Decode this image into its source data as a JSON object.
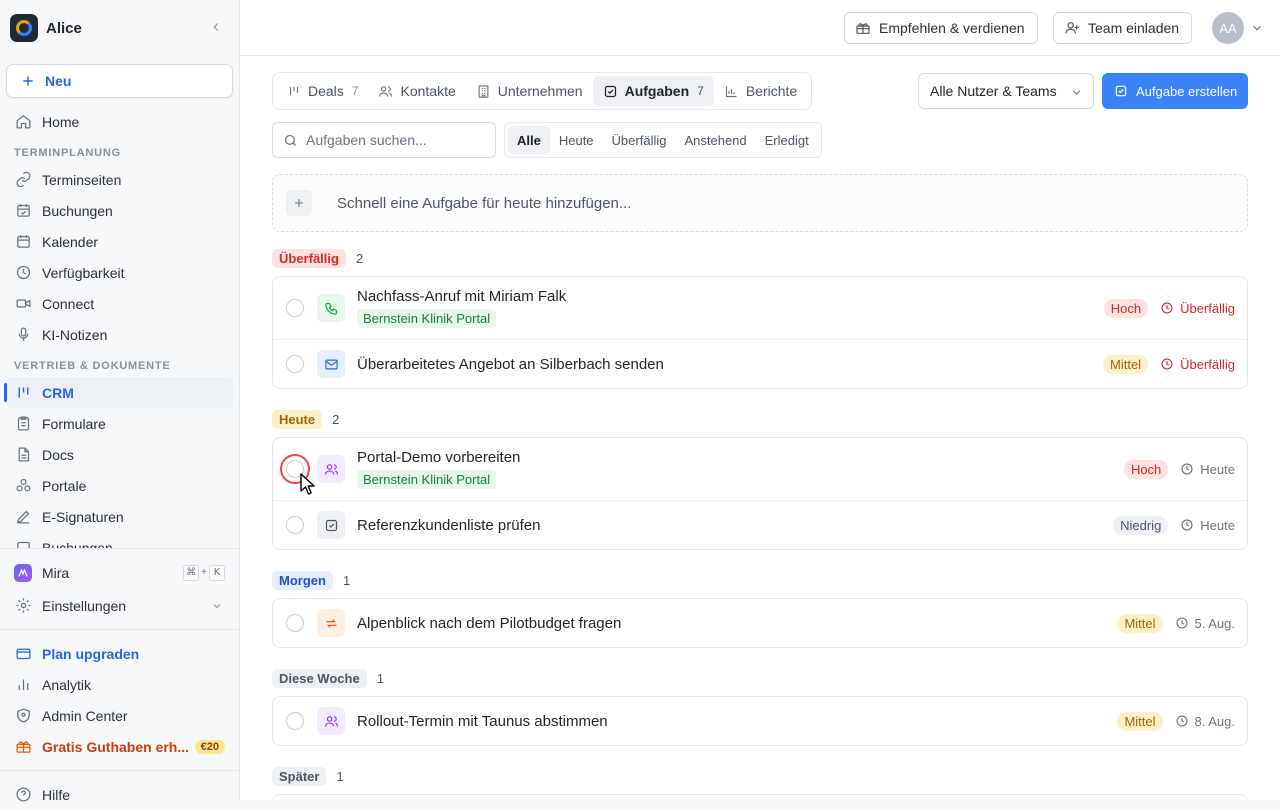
{
  "sidebar": {
    "workspace": "Alice",
    "new_label": "Neu",
    "items_top": [
      {
        "label": "Home",
        "icon": "home-icon"
      }
    ],
    "section1": "TERMINPLANUNG",
    "items_s1": [
      {
        "label": "Terminseiten",
        "icon": "link-icon"
      },
      {
        "label": "Buchungen",
        "icon": "calendar-check-icon"
      },
      {
        "label": "Kalender",
        "icon": "calendar-icon"
      },
      {
        "label": "Verfügbarkeit",
        "icon": "clock-icon"
      },
      {
        "label": "Connect",
        "icon": "video-icon"
      },
      {
        "label": "KI-Notizen",
        "icon": "mic-icon"
      }
    ],
    "section2": "VERTRIEB & DOKUMENTE",
    "items_s2": [
      {
        "label": "CRM",
        "icon": "crm-icon"
      },
      {
        "label": "Formulare",
        "icon": "clipboard-icon"
      },
      {
        "label": "Docs",
        "icon": "doc-icon"
      },
      {
        "label": "Portale",
        "icon": "portal-icon"
      },
      {
        "label": "E-Signaturen",
        "icon": "pen-icon"
      },
      {
        "label": "Buchungen",
        "icon": "calendar-icon"
      }
    ],
    "mira": "Mira",
    "mira_kbd": [
      "⌘",
      "+",
      "K"
    ],
    "settings": "Einstellungen",
    "upgrade": "Plan upgraden",
    "analytics": "Analytik",
    "admin": "Admin Center",
    "credit": "Gratis Guthaben erh...",
    "credit_badge": "€20",
    "help": "Hilfe"
  },
  "topbar": {
    "refer": "Empfehlen & verdienen",
    "invite": "Team einladen",
    "avatar": "AA"
  },
  "tabs": [
    {
      "label": "Deals",
      "count": "7",
      "icon": "pipeline-icon"
    },
    {
      "label": "Kontakte",
      "count": "",
      "icon": "contacts-icon"
    },
    {
      "label": "Unternehmen",
      "count": "",
      "icon": "building-icon"
    },
    {
      "label": "Aufgaben",
      "count": "7",
      "icon": "task-icon",
      "active": true
    },
    {
      "label": "Berichte",
      "count": "",
      "icon": "chart-icon"
    }
  ],
  "user_filter": "Alle Nutzer & Teams",
  "create_task": "Aufgabe erstellen",
  "search_placeholder": "Aufgaben suchen...",
  "filters": [
    "Alle",
    "Heute",
    "Überfällig",
    "Anstehend",
    "Erledigt"
  ],
  "quick_add": "Schnell eine Aufgabe für heute hinzufügen...",
  "groups": [
    {
      "label": "Überfällig",
      "count": "2",
      "style": "red",
      "tasks": [
        {
          "title": "Nachfass-Anruf mit Miriam Falk",
          "tag": "Bernstein Klinik Portal",
          "icon": "phone-icon",
          "icon_style": "green",
          "priority": "Hoch",
          "prio_style": "high",
          "due": "Überfällig",
          "overdue": true
        },
        {
          "title": "Überarbeitetes Angebot an Silberbach senden",
          "tag": "",
          "icon": "mail-icon",
          "icon_style": "blue",
          "priority": "Mittel",
          "prio_style": "mid",
          "due": "Überfällig",
          "overdue": true
        }
      ]
    },
    {
      "label": "Heute",
      "count": "2",
      "style": "yellow",
      "tasks": [
        {
          "title": "Portal-Demo vorbereiten",
          "tag": "Bernstein Klinik Portal",
          "icon": "meeting-icon",
          "icon_style": "purple",
          "priority": "Hoch",
          "prio_style": "high",
          "due": "Heute",
          "overdue": false,
          "focus": true
        },
        {
          "title": "Referenzkundenliste prüfen",
          "tag": "",
          "icon": "checkbox-icon",
          "icon_style": "gray",
          "priority": "Niedrig",
          "prio_style": "low",
          "due": "Heute",
          "overdue": false
        }
      ]
    },
    {
      "label": "Morgen",
      "count": "1",
      "style": "blue",
      "tasks": [
        {
          "title": "Alpenblick nach dem Pilotbudget fragen",
          "tag": "",
          "icon": "repeat-icon",
          "icon_style": "orange",
          "priority": "Mittel",
          "prio_style": "mid",
          "due": "5. Aug.",
          "overdue": false
        }
      ]
    },
    {
      "label": "Diese Woche",
      "count": "1",
      "style": "gray",
      "tasks": [
        {
          "title": "Rollout-Termin mit Taunus abstimmen",
          "tag": "",
          "icon": "meeting-icon",
          "icon_style": "purple",
          "priority": "Mittel",
          "prio_style": "mid",
          "due": "8. Aug.",
          "overdue": false
        }
      ]
    },
    {
      "label": "Später",
      "count": "1",
      "style": "gray",
      "tasks": []
    }
  ]
}
